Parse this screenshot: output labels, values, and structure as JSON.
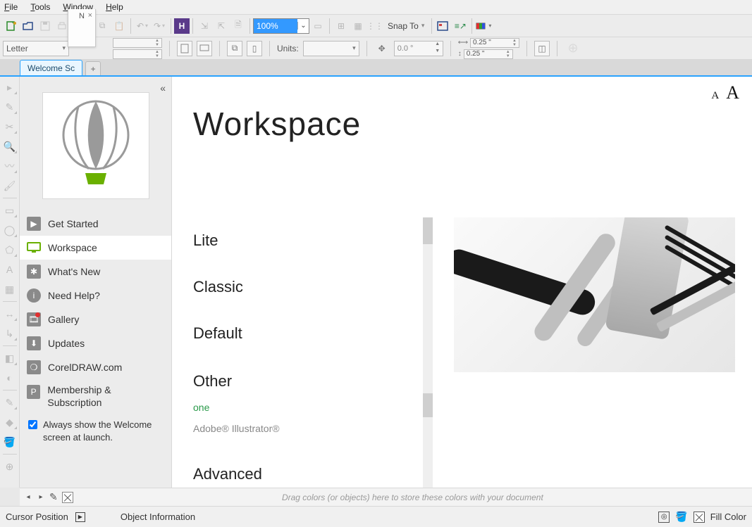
{
  "menu": {
    "file": "File",
    "tools": "Tools",
    "window": "Window",
    "help": "Help"
  },
  "toolbar": {
    "zoom": "100%",
    "snap": "Snap To"
  },
  "propbar": {
    "page_preset": "Letter",
    "units_label": "Units:",
    "rot": "0.0 °",
    "dup_x": "0.25 \"",
    "dup_y": "0.25 \""
  },
  "float_tab": "N",
  "doc_tab": "Welcome Sc",
  "sidebar": {
    "items": [
      {
        "label": "Get Started"
      },
      {
        "label": "Workspace"
      },
      {
        "label": "What's New"
      },
      {
        "label": "Need Help?"
      },
      {
        "label": "Gallery"
      },
      {
        "label": "Updates"
      },
      {
        "label": "CorelDRAW.com"
      },
      {
        "label": "Membership & Subscription"
      }
    ],
    "always_show": "Always show the Welcome screen at launch."
  },
  "content": {
    "title": "Workspace",
    "aa_small": "A",
    "aa_big": "A",
    "opts": {
      "lite": "Lite",
      "classic": "Classic",
      "default": "Default"
    },
    "other_head": "Other",
    "other": {
      "one": "one",
      "ai": "Adobe® Illustrator®"
    },
    "adv_head": "Advanced"
  },
  "colorstrip_hint": "Drag colors (or objects) here to store these colors with your document",
  "status": {
    "cursor": "Cursor Position",
    "objinfo": "Object Information",
    "fill": "Fill Color"
  }
}
